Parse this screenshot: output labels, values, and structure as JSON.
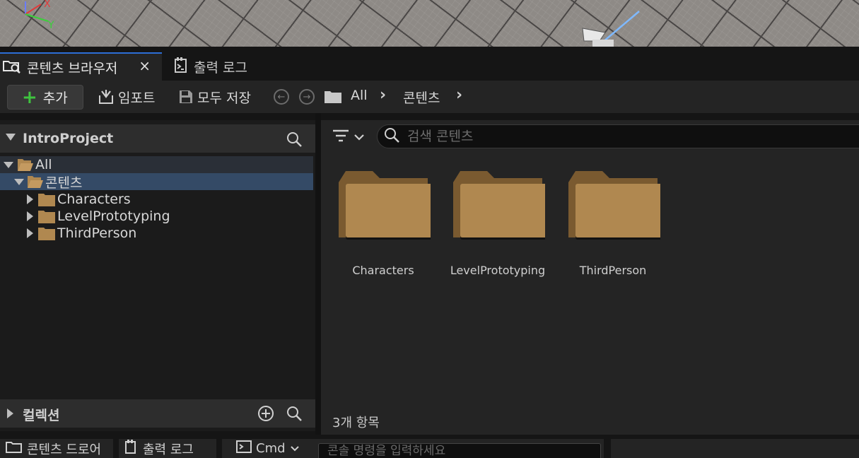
{
  "tabs": [
    {
      "label": "콘텐츠 브라우저",
      "icon": "content-browser-icon",
      "active": true
    },
    {
      "label": "출력 로그",
      "icon": "output-log-icon",
      "active": false
    }
  ],
  "tab_close": "×",
  "toolbar": {
    "add_label": "추가",
    "import_label": "임포트",
    "save_all_label": "모두 저장",
    "breadcrumb": [
      "All",
      "콘텐츠"
    ]
  },
  "sources": {
    "title": "IntroProject",
    "tree": {
      "all": "All",
      "content": "콘텐츠",
      "children": [
        "Characters",
        "LevelPrototyping",
        "ThirdPerson"
      ]
    },
    "collections_title": "컬렉션"
  },
  "content": {
    "search_placeholder": "검색 콘텐츠",
    "items": [
      {
        "name": "Characters",
        "type": "folder"
      },
      {
        "name": "LevelPrototyping",
        "type": "folder"
      },
      {
        "name": "ThirdPerson",
        "type": "folder"
      }
    ],
    "item_count": "3개 항목"
  },
  "bottom": {
    "content_drawer": "콘텐츠 드로어",
    "output_log": "출력 로그",
    "cmd_label": "Cmd",
    "cmd_placeholder": "콘솔 명령을 입력하세요"
  },
  "viewport_axes": {
    "x": "X",
    "y": "Y"
  },
  "colors": {
    "accent": "#2d6ed6",
    "folder": "#b08850",
    "selected_row": "#344a66",
    "add_plus": "#3fc43f"
  }
}
